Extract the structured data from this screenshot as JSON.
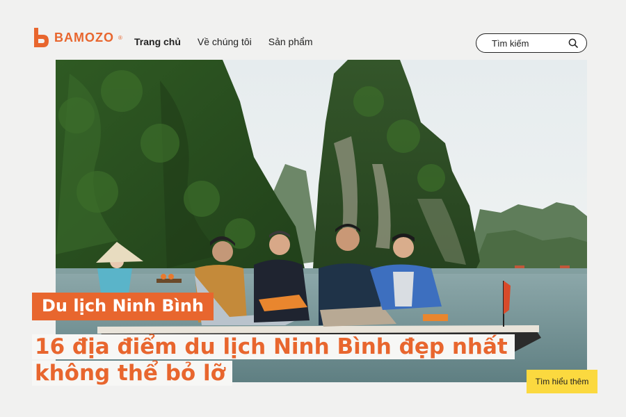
{
  "brand": {
    "name": "BAMOZO",
    "reg": "®",
    "color": "#e8662e"
  },
  "nav": {
    "items": [
      {
        "label": "Trang chủ",
        "active": true
      },
      {
        "label": "Về chúng tôi",
        "active": false
      },
      {
        "label": "Sản phẩm",
        "active": false
      }
    ]
  },
  "search": {
    "placeholder": "Tìm kiếm",
    "icon": "search-icon"
  },
  "hero": {
    "tag": "Du lịch Ninh Bình",
    "title_line1": "16 địa điểm du lịch Ninh Bình đẹp nhất",
    "title_line2": "không thể bỏ lỡ"
  },
  "cta": {
    "label": "Tìm hiểu thêm",
    "color": "#fbd93f"
  }
}
